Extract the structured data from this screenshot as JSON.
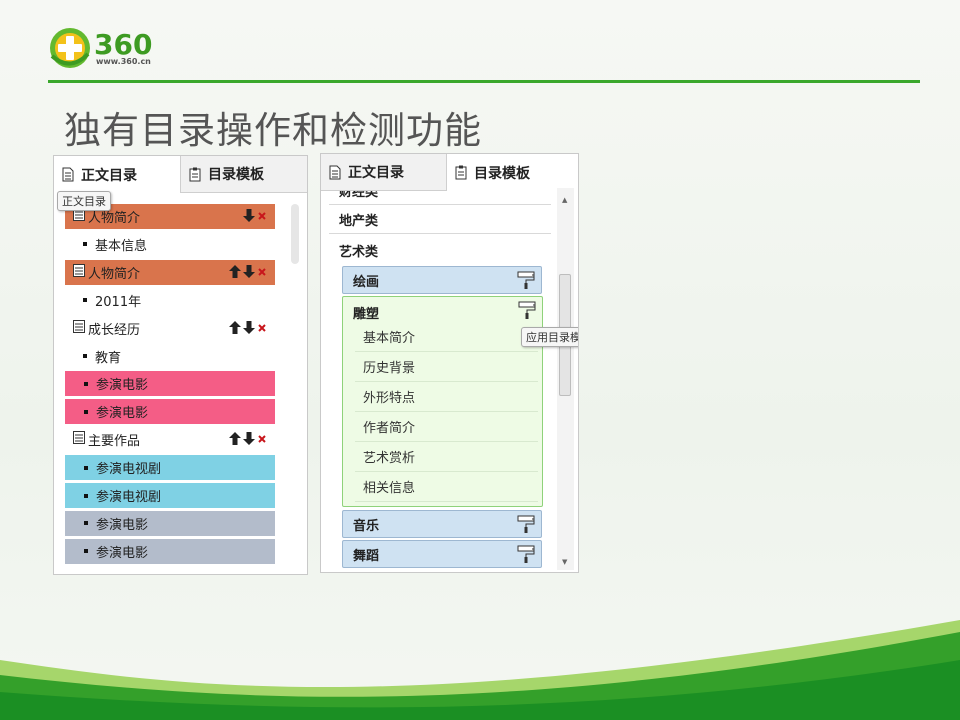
{
  "brand": {
    "logo_text": "360",
    "logo_url_text": "www.360.cn"
  },
  "slide": {
    "title": "独有目录操作和检测功能"
  },
  "colors": {
    "accent_green": "#3aa82c",
    "row_orange": "#d9744c",
    "row_pink": "#f45d86",
    "row_cyan": "#7fd1e4",
    "row_gray": "#b3bccb",
    "group_blue": "#cfe2f2",
    "expanded_green": "#eefbe5"
  },
  "left_panel": {
    "tabs": [
      {
        "label": "正文目录",
        "icon": "document-icon"
      },
      {
        "label": "目录模板",
        "icon": "clipboard-icon"
      }
    ],
    "tooltip": "正文目录",
    "rows": [
      {
        "label": "人物简介",
        "style": "orange",
        "kind": "section",
        "actions": [
          "down"
        ]
      },
      {
        "label": "基本信息",
        "style": "plain",
        "kind": "item",
        "actions": []
      },
      {
        "label": "人物简介",
        "style": "orange",
        "kind": "section",
        "actions": [
          "up",
          "down"
        ]
      },
      {
        "label": "2011年",
        "style": "plain",
        "kind": "item",
        "actions": []
      },
      {
        "label": "成长经历",
        "style": "plain",
        "kind": "section",
        "actions": [
          "up",
          "down"
        ]
      },
      {
        "label": "教育",
        "style": "plain",
        "kind": "item",
        "actions": []
      },
      {
        "label": "参演电影",
        "style": "pink",
        "kind": "item",
        "actions": []
      },
      {
        "label": "参演电影",
        "style": "pink",
        "kind": "item",
        "actions": []
      },
      {
        "label": "主要作品",
        "style": "plain",
        "kind": "section",
        "actions": [
          "up",
          "down"
        ]
      },
      {
        "label": "参演电视剧",
        "style": "cyan",
        "kind": "item",
        "actions": []
      },
      {
        "label": "参演电视剧",
        "style": "cyan",
        "kind": "item",
        "actions": []
      },
      {
        "label": "参演电影",
        "style": "gray",
        "kind": "item",
        "actions": []
      },
      {
        "label": "参演电影",
        "style": "gray",
        "kind": "item",
        "actions": []
      }
    ]
  },
  "right_panel": {
    "tabs": [
      {
        "label": "正文目录",
        "icon": "document-icon"
      },
      {
        "label": "目录模板",
        "icon": "clipboard-icon"
      }
    ],
    "categories": [
      "财经类",
      "地产类",
      "艺术类"
    ],
    "groups_before": [
      {
        "label": "绘画"
      }
    ],
    "expanded_group": {
      "label": "雕塑",
      "items": [
        "基本简介",
        "历史背景",
        "外形特点",
        "作者简介",
        "艺术赏析",
        "相关信息"
      ]
    },
    "groups_after": [
      {
        "label": "音乐"
      },
      {
        "label": "舞蹈"
      }
    ],
    "tooltip": "应用目录模板"
  }
}
